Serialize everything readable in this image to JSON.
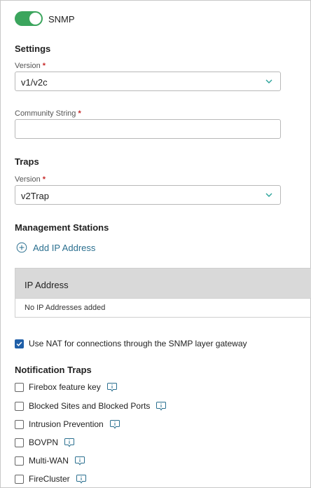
{
  "snmp": {
    "label": "SNMP",
    "enabled": true
  },
  "settings": {
    "heading": "Settings",
    "version_label": "Version",
    "version_value": "v1/v2c",
    "community_label": "Community String",
    "community_value": ""
  },
  "traps": {
    "heading": "Traps",
    "version_label": "Version",
    "version_value": "v2Trap"
  },
  "management": {
    "heading": "Management Stations",
    "add_label": "Add IP Address",
    "table_header": "IP Address",
    "empty_text": "No IP Addresses added"
  },
  "nat": {
    "label": "Use NAT for connections through the SNMP layer gateway",
    "checked": true
  },
  "notification": {
    "heading": "Notification Traps",
    "items": [
      {
        "label": "Firebox feature key",
        "checked": false
      },
      {
        "label": "Blocked Sites and Blocked Ports",
        "checked": false
      },
      {
        "label": "Intrusion Prevention",
        "checked": false
      },
      {
        "label": "BOVPN",
        "checked": false
      },
      {
        "label": "Multi-WAN",
        "checked": false
      },
      {
        "label": "FireCluster",
        "checked": false
      }
    ]
  },
  "required_marker": "*",
  "colors": {
    "toggle_on": "#3ba55d",
    "accent": "#2a6f8f",
    "checkbox": "#1f5fa8",
    "required": "#c62828"
  },
  "icons": {
    "chevron": "chevron-down-icon",
    "add": "plus-circle-icon",
    "info": "info-icon"
  }
}
